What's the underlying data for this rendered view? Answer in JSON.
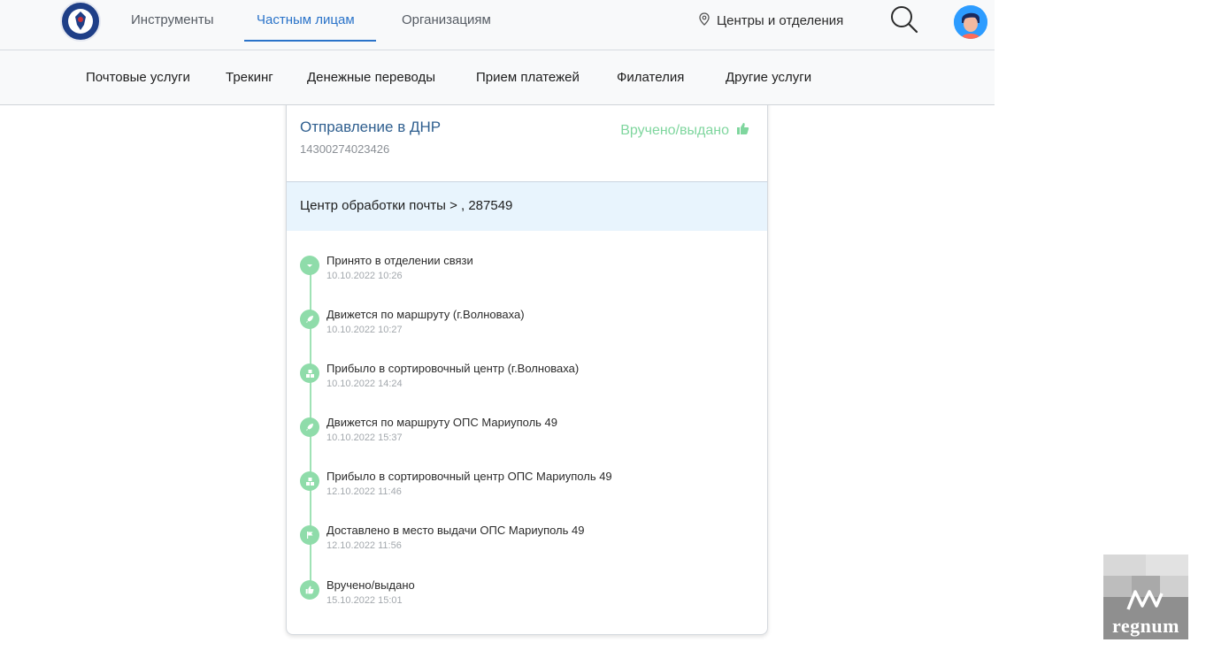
{
  "header": {
    "nav": [
      {
        "label": "Инструменты",
        "active": false
      },
      {
        "label": "Частным лицам",
        "active": true
      },
      {
        "label": "Организациям",
        "active": false
      }
    ],
    "centers_label": "Центры и отделения",
    "icons": {
      "location": "map-pin-icon",
      "search": "search-icon",
      "avatar": "user-avatar"
    },
    "accent_color": "#2a73c9"
  },
  "subnav": {
    "items": [
      {
        "label": "Почтовые услуги"
      },
      {
        "label": "Трекинг"
      },
      {
        "label": "Денежные переводы"
      },
      {
        "label": "Прием платежей"
      },
      {
        "label": "Филателия"
      },
      {
        "label": "Другие услуги"
      }
    ]
  },
  "shipment": {
    "title": "Отправление в ДНР",
    "number": "14300274023426",
    "status": "Вручено/выдано",
    "status_icon": "thumbs-up-icon",
    "status_color": "#7fd69e",
    "location": "Центр обработки почты > , 287549"
  },
  "timeline": [
    {
      "label": "Принято в отделении связи",
      "time": "10.10.2022 10:26",
      "icon": "chevron-down-icon"
    },
    {
      "label": "Движется по маршруту (г.Волноваха)",
      "time": "10.10.2022 10:27",
      "icon": "rocket-icon"
    },
    {
      "label": "Прибыло в сортировочный центр (г.Волноваха)",
      "time": "10.10.2022 14:24",
      "icon": "cubes-icon"
    },
    {
      "label": "Движется по маршруту ОПС Мариуполь 49",
      "time": "10.10.2022 15:37",
      "icon": "rocket-icon"
    },
    {
      "label": "Прибыло в сортировочный центр ОПС Мариуполь 49",
      "time": "12.10.2022 11:46",
      "icon": "cubes-icon"
    },
    {
      "label": "Доставлено в место выдачи ОПС Мариуполь 49",
      "time": "12.10.2022 11:56",
      "icon": "flag-icon"
    },
    {
      "label": "Вручено/выдано",
      "time": "15.10.2022 15:01",
      "icon": "thumbs-up-icon"
    }
  ],
  "watermark": {
    "text": "regnum"
  }
}
